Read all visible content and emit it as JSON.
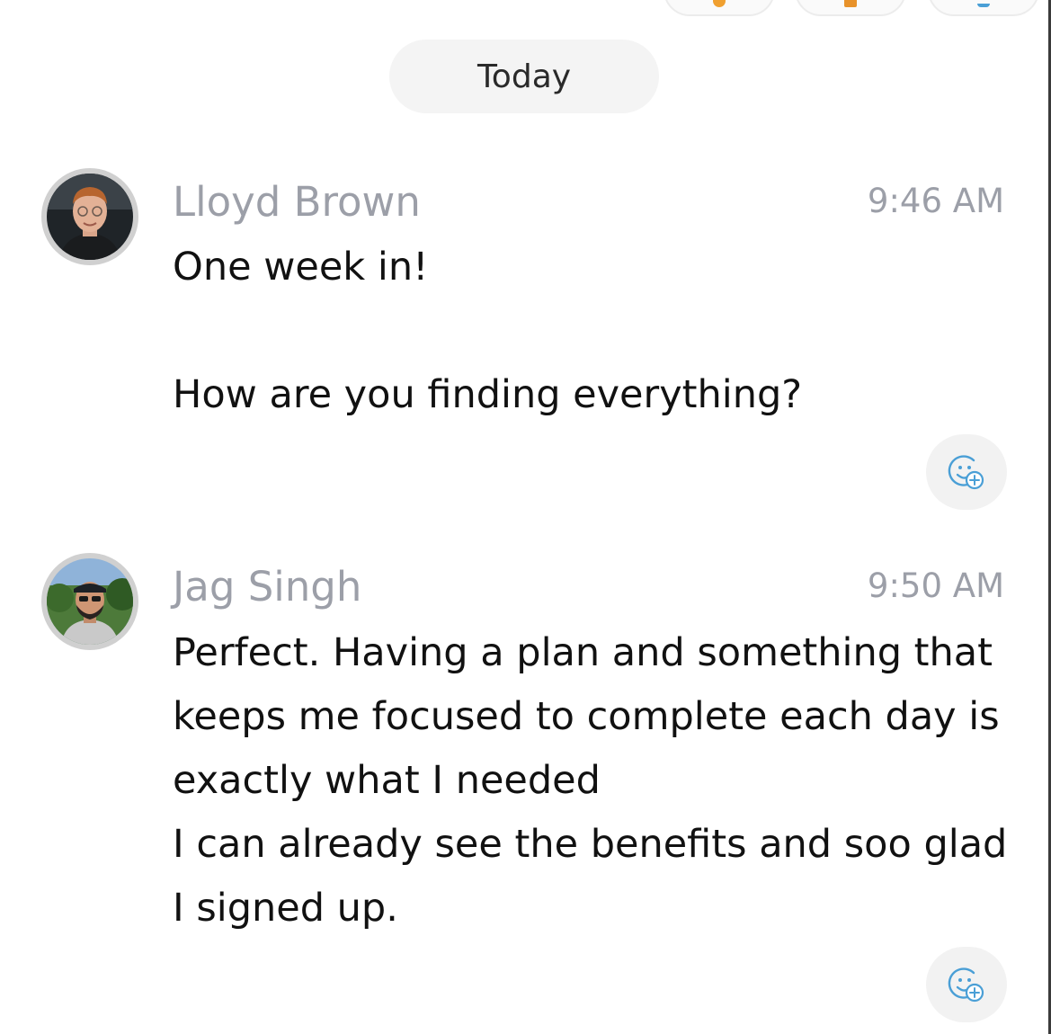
{
  "colors": {
    "sender_name": "#9c9fa8",
    "timestamp": "#9c9fa8",
    "message_text": "#111111",
    "date_pill_bg": "#f4f4f4",
    "react_icon": "#4a9fd6",
    "chip_orange": "#f0a030"
  },
  "date_divider": {
    "label": "Today"
  },
  "messages": [
    {
      "sender": "Lloyd Brown",
      "time": "9:46 AM",
      "text": "One week in!\n\nHow are you finding everything?",
      "avatar_icon": "avatar-photo",
      "react_icon": "add-reaction-icon"
    },
    {
      "sender": "Jag Singh",
      "time": "9:50 AM",
      "text": "Perfect. Having a plan and something that keeps me focused to complete each day is exactly what I needed\n I can already see the benefits and soo glad I signed up.",
      "avatar_icon": "avatar-photo",
      "react_icon": "add-reaction-icon"
    }
  ]
}
